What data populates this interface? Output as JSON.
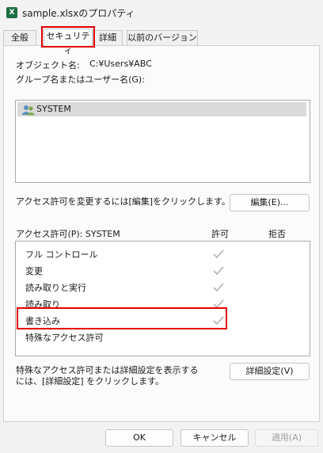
{
  "window": {
    "title": "sample.xlsxのプロパティ"
  },
  "tabs": [
    {
      "label": "全般",
      "active": false
    },
    {
      "label": "セキュリティ",
      "active": true
    },
    {
      "label": "詳細",
      "active": false
    },
    {
      "label": "以前のバージョン",
      "active": false
    }
  ],
  "security": {
    "object_label": "オブジェクト名:",
    "object_value": "C:¥Users¥ABC",
    "groups_label": "グループ名またはユーザー名(G):",
    "users": [
      {
        "name": "SYSTEM",
        "icon": "users-icon",
        "selected": true
      }
    ],
    "change_hint": "アクセス許可を変更するには[編集]をクリックします。",
    "edit_button": "編集(E)...",
    "permissions_label": "アクセス許可(P): SYSTEM",
    "allow_header": "許可",
    "deny_header": "拒否",
    "permissions": [
      {
        "name": "フル コントロール",
        "allow": true,
        "deny": false
      },
      {
        "name": "変更",
        "allow": true,
        "deny": false
      },
      {
        "name": "読み取りと実行",
        "allow": true,
        "deny": false
      },
      {
        "name": "読み取り",
        "allow": true,
        "deny": false
      },
      {
        "name": "書き込み",
        "allow": true,
        "deny": false
      },
      {
        "name": "特殊なアクセス許可",
        "allow": false,
        "deny": false
      }
    ],
    "advanced_hint_line1": "特殊なアクセス許可または詳細設定を表示する",
    "advanced_hint_line2": "には、[詳細設定] をクリックします。",
    "advanced_button": "詳細設定(V)"
  },
  "footer": {
    "ok": "OK",
    "cancel": "キャンセル",
    "apply": "適用(A)",
    "apply_enabled": false
  },
  "colors": {
    "highlight": "#e60000",
    "check": "#b0b0b0"
  }
}
